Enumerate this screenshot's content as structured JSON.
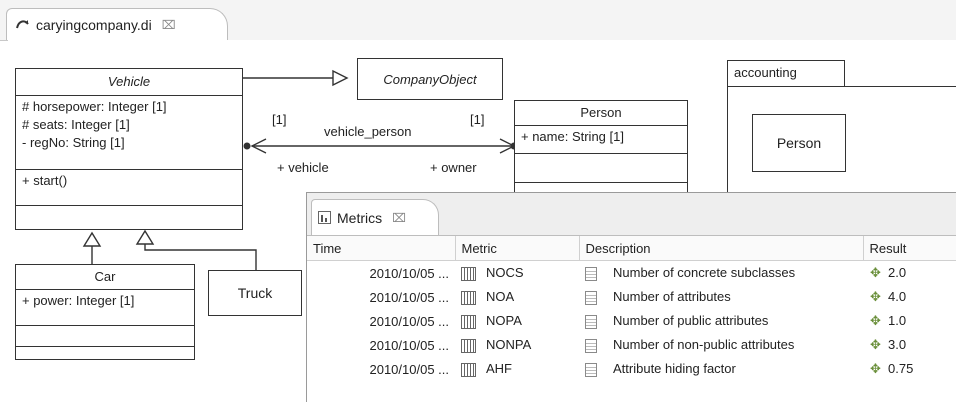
{
  "editor": {
    "tab_title": "caryingcompany.di",
    "close_glyph": "⌧"
  },
  "diagram": {
    "vehicle": {
      "name": "Vehicle",
      "attributes": [
        "# horsepower: Integer [1]",
        "# seats: Integer [1]",
        "- regNo: String [1]"
      ],
      "operations": [
        "+ start()"
      ]
    },
    "company_object": {
      "name": "CompanyObject"
    },
    "person": {
      "name": "Person",
      "attributes": [
        "+ name: String [1]"
      ]
    },
    "car": {
      "name": "Car",
      "attributes": [
        "+ power: Integer [1]"
      ]
    },
    "truck": {
      "name": "Truck"
    },
    "association": {
      "name": "vehicle_person",
      "left_multiplicity": "[1]",
      "right_multiplicity": "[1]",
      "left_role": "+ vehicle",
      "right_role": "+ owner"
    },
    "package": {
      "name": "accounting",
      "inner_class": "Person"
    }
  },
  "metrics": {
    "tab_title": "Metrics",
    "close_glyph": "⌧",
    "columns": [
      "Time",
      "Metric",
      "Description",
      "Result"
    ],
    "rows": [
      {
        "time": "2010/10/05 ...",
        "metric": "NOCS",
        "description": "Number of concrete subclasses",
        "result": "2.0"
      },
      {
        "time": "2010/10/05 ...",
        "metric": "NOA",
        "description": "Number of attributes",
        "result": "4.0"
      },
      {
        "time": "2010/10/05 ...",
        "metric": "NOPA",
        "description": "Number of public attributes",
        "result": "1.0"
      },
      {
        "time": "2010/10/05 ...",
        "metric": "NONPA",
        "description": "Number of non-public attributes",
        "result": "3.0"
      },
      {
        "time": "2010/10/05 ...",
        "metric": "AHF",
        "description": "Attribute hiding factor",
        "result": "0.75"
      }
    ]
  }
}
